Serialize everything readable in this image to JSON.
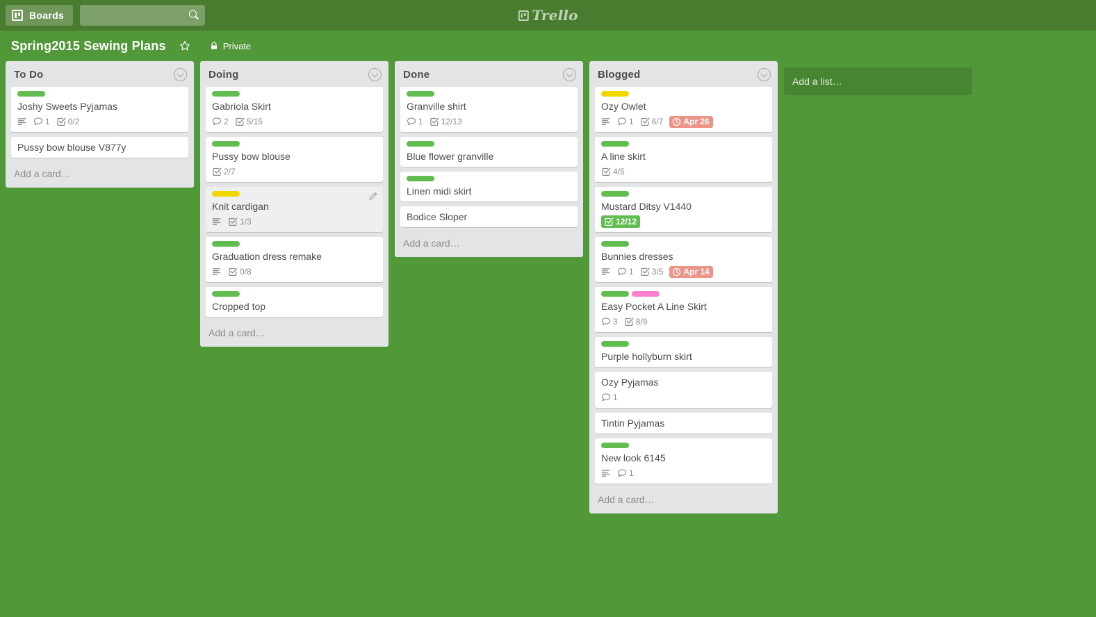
{
  "topbar": {
    "boards_button": "Boards",
    "boards_icon": "boards-icon",
    "search_placeholder": "",
    "search_value": "",
    "search_icon": "search-icon",
    "brand": "Trello",
    "brand_icon": "trello-logo-icon"
  },
  "board": {
    "title": "Spring2015 Sewing Plans",
    "star_icon": "star-icon",
    "lock_icon": "lock-icon",
    "visibility": "Private"
  },
  "colors": {
    "topbar_bg": "#4a7c2f",
    "board_bg": "#519839",
    "list_bg": "#e2e4e6",
    "card_bg": "#ffffff",
    "label_green": "#61bd4f",
    "label_yellow": "#f2d600",
    "label_pink": "#ff80ce",
    "due_badge": "#ec9488",
    "checklist_complete": "#61bd4f",
    "text_dark": "#4d4d4d",
    "text_muted": "#8c8c8c"
  },
  "add_list": {
    "label": "Add a list…"
  },
  "lists": [
    {
      "title": "To Do",
      "menu_icon": "chevron-down-circle-icon",
      "add_card": "Add a card…",
      "cards": [
        {
          "title": "Joshy Sweets Pyjamas",
          "labels": [
            "#61bd4f"
          ],
          "description": true,
          "comments": "1",
          "checklist": "0/2",
          "checklist_complete": false,
          "due": null,
          "hovered": false
        },
        {
          "title": "Pussy bow blouse V877y",
          "labels": [],
          "description": false,
          "comments": null,
          "checklist": null,
          "checklist_complete": false,
          "due": null,
          "hovered": false
        }
      ]
    },
    {
      "title": "Doing",
      "menu_icon": "chevron-down-circle-icon",
      "add_card": "Add a card…",
      "cards": [
        {
          "title": "Gabriola Skirt",
          "labels": [
            "#61bd4f"
          ],
          "description": false,
          "comments": "2",
          "checklist": "5/15",
          "checklist_complete": false,
          "due": null,
          "hovered": false
        },
        {
          "title": "Pussy bow blouse",
          "labels": [
            "#61bd4f"
          ],
          "description": false,
          "comments": null,
          "checklist": "2/7",
          "checklist_complete": false,
          "due": null,
          "hovered": false
        },
        {
          "title": "Knit cardigan",
          "labels": [
            "#f2d600"
          ],
          "description": true,
          "comments": null,
          "checklist": "1/3",
          "checklist_complete": false,
          "due": null,
          "hovered": true
        },
        {
          "title": "Graduation dress remake",
          "labels": [
            "#61bd4f"
          ],
          "description": true,
          "comments": null,
          "checklist": "0/8",
          "checklist_complete": false,
          "due": null,
          "hovered": false
        },
        {
          "title": "Cropped top",
          "labels": [
            "#61bd4f"
          ],
          "description": false,
          "comments": null,
          "checklist": null,
          "checklist_complete": false,
          "due": null,
          "hovered": false
        }
      ]
    },
    {
      "title": "Done",
      "menu_icon": "chevron-down-circle-icon",
      "add_card": "Add a card…",
      "cards": [
        {
          "title": "Granville shirt",
          "labels": [
            "#61bd4f"
          ],
          "description": false,
          "comments": "1",
          "checklist": "12/13",
          "checklist_complete": false,
          "due": null,
          "hovered": false
        },
        {
          "title": "Blue flower granville",
          "labels": [
            "#61bd4f"
          ],
          "description": false,
          "comments": null,
          "checklist": null,
          "checklist_complete": false,
          "due": null,
          "hovered": false
        },
        {
          "title": "Linen midi skirt",
          "labels": [
            "#61bd4f"
          ],
          "description": false,
          "comments": null,
          "checklist": null,
          "checklist_complete": false,
          "due": null,
          "hovered": false
        },
        {
          "title": "Bodice Sloper",
          "labels": [],
          "description": false,
          "comments": null,
          "checklist": null,
          "checklist_complete": false,
          "due": null,
          "hovered": false
        }
      ]
    },
    {
      "title": "Blogged",
      "menu_icon": "chevron-down-circle-icon",
      "add_card": "Add a card…",
      "cards": [
        {
          "title": "Ozy Owlet",
          "labels": [
            "#f2d600"
          ],
          "description": true,
          "comments": "1",
          "checklist": "6/7",
          "checklist_complete": false,
          "due": "Apr 26",
          "hovered": false
        },
        {
          "title": "A line skirt",
          "labels": [
            "#61bd4f"
          ],
          "description": false,
          "comments": null,
          "checklist": "4/5",
          "checklist_complete": false,
          "due": null,
          "hovered": false
        },
        {
          "title": "Mustard Ditsy V1440",
          "labels": [
            "#61bd4f"
          ],
          "description": false,
          "comments": null,
          "checklist": "12/12",
          "checklist_complete": true,
          "due": null,
          "hovered": false
        },
        {
          "title": "Bunnies dresses",
          "labels": [
            "#61bd4f"
          ],
          "description": true,
          "comments": "1",
          "checklist": "3/5",
          "checklist_complete": false,
          "due": "Apr 14",
          "hovered": false
        },
        {
          "title": "Easy Pocket A Line Skirt",
          "labels": [
            "#61bd4f",
            "#ff80ce"
          ],
          "description": false,
          "comments": "3",
          "checklist": "8/9",
          "checklist_complete": false,
          "due": null,
          "hovered": false
        },
        {
          "title": "Purple hollyburn skirt",
          "labels": [
            "#61bd4f"
          ],
          "description": false,
          "comments": null,
          "checklist": null,
          "checklist_complete": false,
          "due": null,
          "hovered": false
        },
        {
          "title": "Ozy Pyjamas",
          "labels": [],
          "description": false,
          "comments": "1",
          "checklist": null,
          "checklist_complete": false,
          "due": null,
          "hovered": false
        },
        {
          "title": "Tintin Pyjamas",
          "labels": [],
          "description": false,
          "comments": null,
          "checklist": null,
          "checklist_complete": false,
          "due": null,
          "hovered": false
        },
        {
          "title": "New look 6145",
          "labels": [
            "#61bd4f"
          ],
          "description": true,
          "comments": "1",
          "checklist": null,
          "checklist_complete": false,
          "due": null,
          "hovered": false
        }
      ]
    }
  ]
}
